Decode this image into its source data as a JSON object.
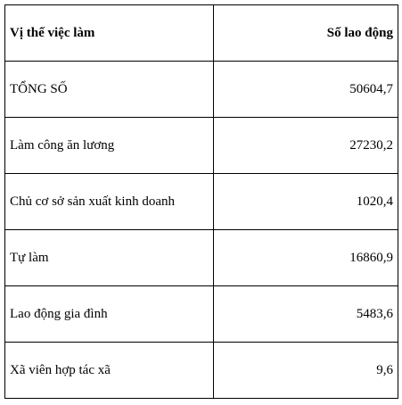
{
  "table": {
    "headers": {
      "category": "Vị thế việc làm",
      "value": "Số lao động"
    },
    "rows": [
      {
        "label": "TỔNG SỐ",
        "value": "50604,7"
      },
      {
        "label": "Làm công ăn lương",
        "value": "27230,2"
      },
      {
        "label": "Chủ cơ sở sản xuất kinh doanh",
        "value": "1020,4"
      },
      {
        "label": "Tự làm",
        "value": "16860,9"
      },
      {
        "label": "Lao động gia đình",
        "value": "5483,6"
      },
      {
        "label": "Xã viên hợp tác xã",
        "value": "9,6"
      }
    ]
  }
}
